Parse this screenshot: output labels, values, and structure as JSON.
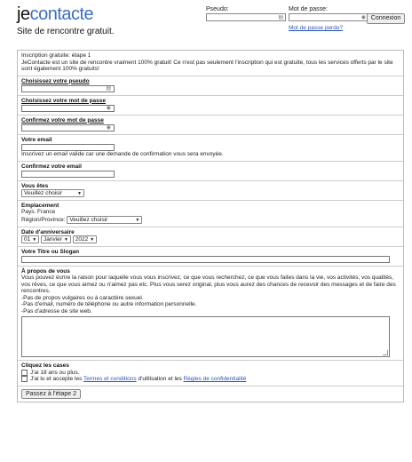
{
  "header": {
    "logo_je": "je",
    "logo_contacte": "contacte",
    "tagline": "Site de rencontre gratuit."
  },
  "login": {
    "pseudo_label": "Pseudo:",
    "password_label": "Mot de passe:",
    "connect_label": "Connexion",
    "lost_password": "Mot de passe perdu?"
  },
  "intro": {
    "title": "Inscription gratuite: étape 1",
    "text": "JeContacte est un site de rencontre vraiment 100% gratuit! Ce n'est pas seulement l'inscription qui est gratuite, tous les services offerts par le site sont également 100% gratuits!"
  },
  "pseudo": {
    "label": "Choisissez votre pseudo"
  },
  "password": {
    "label": "Choisissez votre mot de passe"
  },
  "password_confirm": {
    "label": "Confirmez votre mot de passe"
  },
  "email": {
    "label": "Votre email",
    "hint": "Inscrivez un email valide car une demande de confirmation vous sera envoyée."
  },
  "email_confirm": {
    "label": "Confirmez votre email"
  },
  "gender": {
    "label": "Vous êtes",
    "value": "Veuillez choisir"
  },
  "location": {
    "label": "Emplacement",
    "country": "Pays: France",
    "region_label": "Région/Province:",
    "region_value": "Veuillez choisir"
  },
  "birthday": {
    "label": "Date d'anniversaire",
    "day": "01",
    "month": "Janvier",
    "year": "2022"
  },
  "slogan": {
    "label": "Votre Titre ou Slogan"
  },
  "about": {
    "label": "À propos de vous",
    "text": "Vous pouvez écrire la raison pour laquelle vous vous inscrivez, ce que vous recherchez, ce que vous faites dans la vie, vos activités, vos qualités, vos rêves, ce que vous aimez ou n'aimez pas etc. Plus vous serez original, plus vous aurez des chances de recevoir des messages et de faire des rencontres.",
    "rule1": "-Pas de propos vulgaires ou à caractère sexuel.",
    "rule2": "-Pas d'email, numéro de téléphone ou autre information personnelle.",
    "rule3": "-Pas d'adresse de site web."
  },
  "checks": {
    "label": "Cliquez les cases",
    "age": "J'ai 18 ans ou plus.",
    "terms_prefix": "J'ai lu et accepte les ",
    "terms_link": "Termes et conditions",
    "terms_mid": " d'utilisation et les ",
    "privacy_link": "Règles de confidentialité"
  },
  "submit": {
    "label": "Passez à l'étape 2"
  }
}
